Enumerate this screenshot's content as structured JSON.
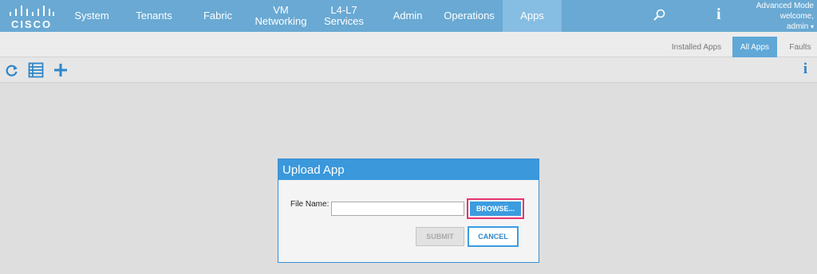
{
  "brand": {
    "logo_text": "CISCO"
  },
  "nav": {
    "items": [
      {
        "label": "System"
      },
      {
        "label": "Tenants"
      },
      {
        "label": "Fabric"
      },
      {
        "label_line1": "VM",
        "label_line2": "Networking"
      },
      {
        "label_line1": "L4-L7",
        "label_line2": "Services"
      },
      {
        "label": "Admin"
      },
      {
        "label": "Operations"
      },
      {
        "label": "Apps"
      }
    ],
    "active": "Apps",
    "search_icon": "search-icon",
    "info_icon": "info-icon"
  },
  "user": {
    "mode": "Advanced Mode",
    "welcome": "welcome,",
    "name": "admin",
    "caret": "▾"
  },
  "subtabs": {
    "items": [
      "Installed Apps",
      "All Apps",
      "Faults"
    ],
    "active": "All Apps"
  },
  "toolbar": {
    "icons": [
      "refresh-icon",
      "list-icon",
      "add-icon"
    ],
    "info_icon": "info-icon",
    "info_glyph": "i"
  },
  "dialog": {
    "title": "Upload App",
    "file_label": "File Name:",
    "file_value": "",
    "browse_label": "BROWSE...",
    "submit_label": "SUBMIT",
    "cancel_label": "CANCEL"
  },
  "colors": {
    "nav_bg": "#69a9d3",
    "accent": "#3b9ce0",
    "highlight": "#e8346f"
  }
}
